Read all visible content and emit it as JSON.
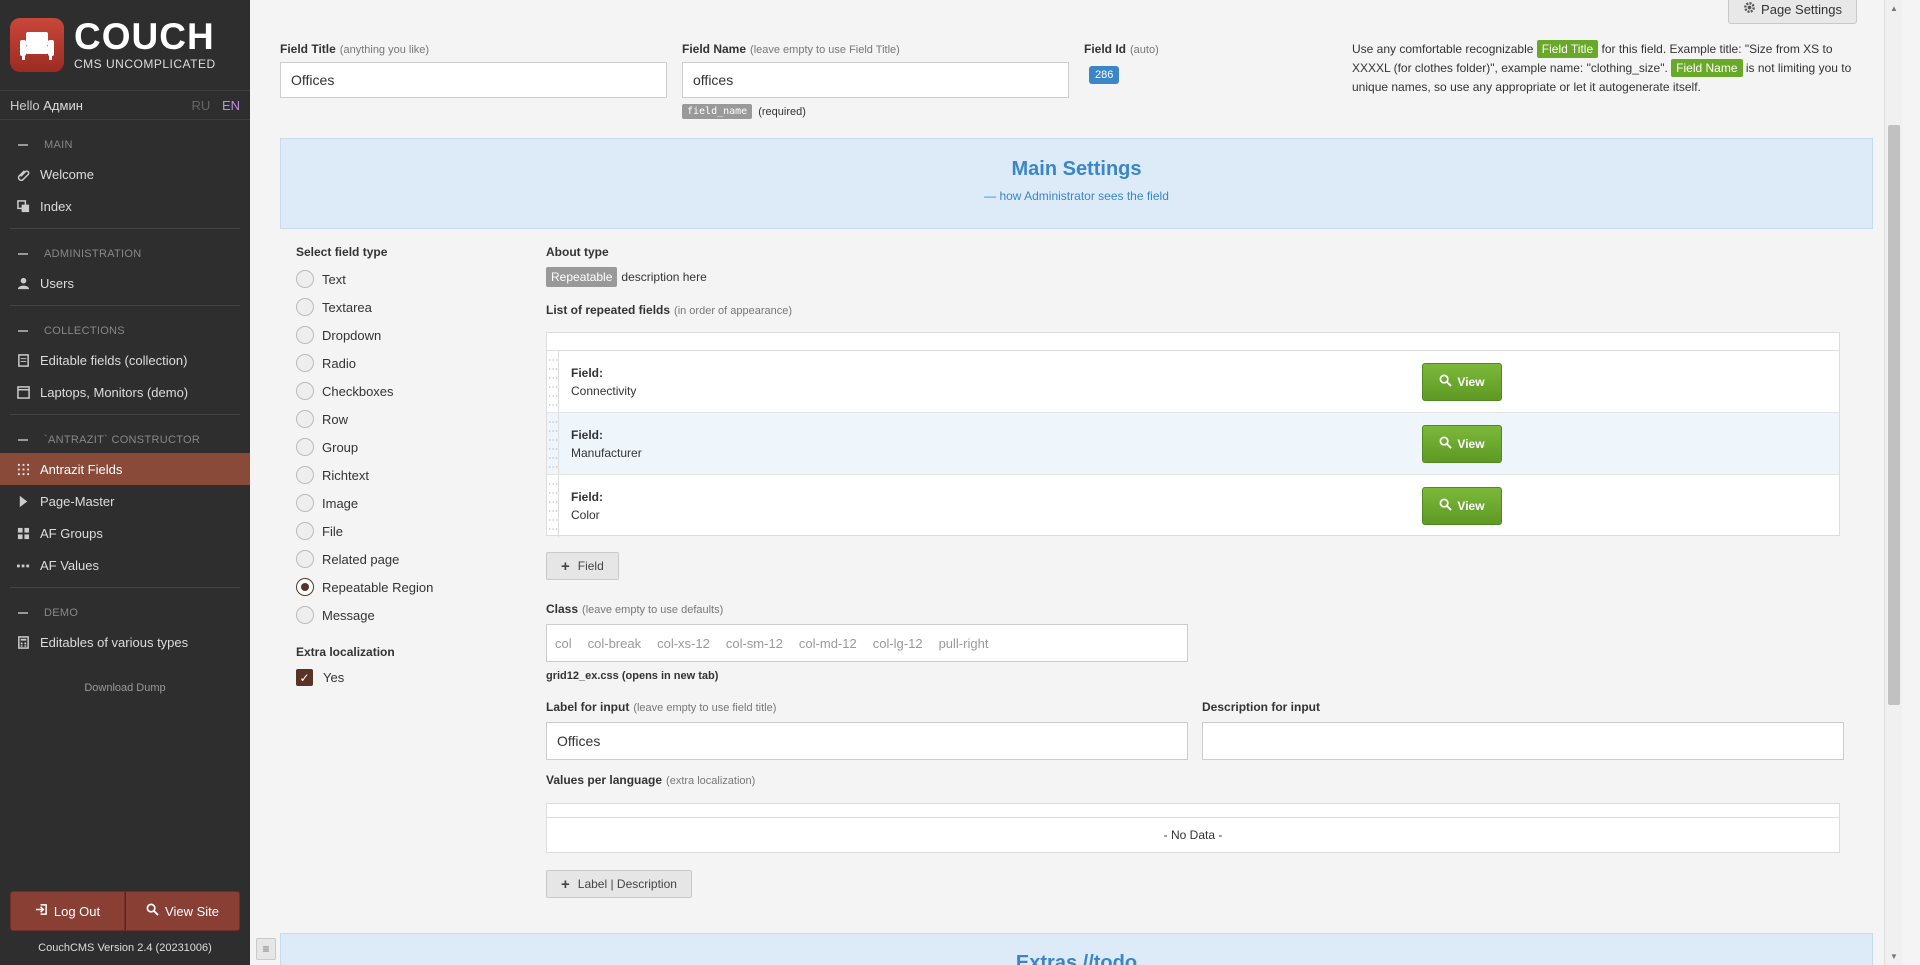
{
  "sidebar": {
    "logo_title": "COUCH",
    "logo_subtitle": "CMS UNCOMPLICATED",
    "hello_prefix": "Hello",
    "user_name": "Админ",
    "lang_ru": "RU",
    "lang_en": "EN",
    "sections": [
      {
        "title": "MAIN",
        "items": [
          {
            "label": "Welcome",
            "icon": "paperclip-icon"
          },
          {
            "label": "Index",
            "icon": "pages-icon"
          }
        ]
      },
      {
        "title": "ADMINISTRATION",
        "items": [
          {
            "label": "Users",
            "icon": "user-icon"
          }
        ]
      },
      {
        "title": "COLLECTIONS",
        "items": [
          {
            "label": "Editable fields (collection)",
            "icon": "document-icon"
          },
          {
            "label": "Laptops, Monitors (demo)",
            "icon": "window-icon"
          }
        ]
      },
      {
        "title": "`ANTRAZIT` CONSTRUCTOR",
        "items": [
          {
            "label": "Antrazit Fields",
            "icon": "grid-dots-icon",
            "active": true
          },
          {
            "label": "Page-Master",
            "icon": "chevron-right-icon"
          },
          {
            "label": "AF Groups",
            "icon": "grid-icon"
          },
          {
            "label": "AF Values",
            "icon": "ellipsis-icon"
          }
        ]
      },
      {
        "title": "DEMO",
        "items": [
          {
            "label": "Editables of various types",
            "icon": "calculator-icon"
          }
        ]
      }
    ],
    "download_dump": "Download Dump",
    "logout_label": "Log Out",
    "view_site_label": "View Site",
    "version": "CouchCMS Version 2.4 (20231006)"
  },
  "header": {
    "page_settings_label": "Page Settings"
  },
  "form": {
    "field_title": {
      "label": "Field Title",
      "hint": "(anything you like)",
      "value": "Offices"
    },
    "field_name": {
      "label": "Field Name",
      "hint": "(leave empty to use Field Title)",
      "value": "offices",
      "badge": "field_name",
      "required": "(required)"
    },
    "field_id": {
      "label": "Field Id",
      "hint": "(auto)",
      "value": "286"
    },
    "help": {
      "part1": "Use any comfortable recognizable",
      "tag_title": "Field Title",
      "part2": "for this field. Example title: \"Size from XS to XXXXL (for clothes folder)\", example name: \"clothing_size\".",
      "tag_name": "Field Name",
      "part3": "is not limiting you to unique names, so use any appropriate or let it autogenerate itself."
    }
  },
  "main_settings": {
    "title": "Main Settings",
    "subtitle": "— how Administrator sees the field"
  },
  "field_types": {
    "title": "Select field type",
    "options": [
      "Text",
      "Textarea",
      "Dropdown",
      "Radio",
      "Checkboxes",
      "Row",
      "Group",
      "Richtext",
      "Image",
      "File",
      "Related page",
      "Repeatable Region",
      "Message"
    ],
    "selected": "Repeatable Region",
    "extra_localization_title": "Extra localization",
    "extra_localization_option": "Yes"
  },
  "about_type": {
    "title": "About type",
    "badge": "Repeatable",
    "description": "description here"
  },
  "repeated_fields": {
    "title": "List of repeated fields",
    "hint": "(in order of appearance)",
    "field_key": "Field:",
    "rows": [
      "Connectivity",
      "Manufacturer",
      "Color"
    ],
    "view_label": "View",
    "add_label": "Field"
  },
  "class_field": {
    "label": "Class",
    "hint": "(leave empty to use defaults)",
    "placeholders": [
      "col",
      "col-break",
      "col-xs-12",
      "col-sm-12",
      "col-md-12",
      "col-lg-12",
      "pull-right"
    ],
    "link_file": "grid12_ex.css",
    "link_note": "(opens in new tab)"
  },
  "label_input": {
    "label": "Label for input",
    "hint": "(leave empty to use field title)",
    "value": "Offices"
  },
  "description_input": {
    "label": "Description for input",
    "value": ""
  },
  "values_per_language": {
    "title": "Values per language",
    "hint": "(extra localization)",
    "no_data": "- No Data -",
    "add_label": "Label | Description"
  },
  "extras": {
    "title": "Extras //todo"
  },
  "colors": {
    "sidebar_bg": "#2e2e2e",
    "active_item": "#8a4a3a",
    "accent_blue": "#3a86c8",
    "green": "#6aa829"
  }
}
